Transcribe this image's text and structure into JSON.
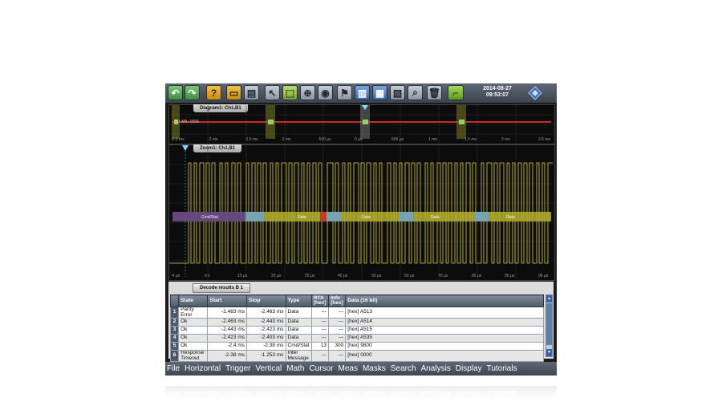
{
  "toolbar": {
    "icons": [
      "undo-icon",
      "redo-icon",
      "help-icon",
      "open-folder-icon",
      "layout-icon",
      "pointer-icon",
      "select-icon",
      "zoom-icon",
      "measure-icon",
      "cursor-icon",
      "mask-icon",
      "histogram-icon",
      "trigger-icon",
      "search-icon",
      "waveform-icon",
      "delete-icon",
      "mini-wave-icon"
    ],
    "date": "2014-08-27",
    "time": "09:53:07"
  },
  "diagram": {
    "tab_label": "Diagram1: Ch1,B1",
    "bus_label": "B1:MIL-1553",
    "x_labels": [
      "-2.5 ms",
      "-2 ms",
      "-1.5 ms",
      "-1 ms",
      "-500 µs",
      "0 µs",
      "500 µs",
      "1 ms",
      "1.5 ms",
      "2 ms",
      "2.5 ms"
    ]
  },
  "zoom": {
    "tab_label": "Zoom1: Ch1,B1",
    "x_labels": [
      "-4 µs",
      "0 s",
      "10 µs",
      "20 µs",
      "30 µs",
      "40 µs",
      "50 µs",
      "60 µs",
      "70 µs",
      "80 µs",
      "90 µs",
      "96 µs"
    ],
    "decode_labels": [
      "Cmd/Stat",
      "Data",
      "Data",
      "Data",
      "Data"
    ]
  },
  "decode": {
    "tab_label": "Decode results B 1",
    "columns": [
      "State",
      "Start",
      "Stop",
      "Type",
      "RTA [hex]",
      "Info [hex]",
      "Data (16 bit)"
    ],
    "rows": [
      {
        "index": "1",
        "state": "Parity Error",
        "start": "-2.483 ms",
        "stop": "-2.463 ms",
        "type": "Data",
        "rta": "---",
        "info": "---",
        "data": "[hex] A513"
      },
      {
        "index": "2",
        "state": "Ok",
        "start": "-2.463 ms",
        "stop": "-2.443 ms",
        "type": "Data",
        "rta": "---",
        "info": "---",
        "data": "[hex] A514"
      },
      {
        "index": "3",
        "state": "Ok",
        "start": "-2.443 ms",
        "stop": "-2.423 ms",
        "type": "Data",
        "rta": "---",
        "info": "---",
        "data": "[hex] A515"
      },
      {
        "index": "4",
        "state": "Ok",
        "start": "-2.423 ms",
        "stop": "-2.403 ms",
        "type": "Data",
        "rta": "---",
        "info": "---",
        "data": "[hex] A535"
      },
      {
        "index": "5",
        "state": "Ok",
        "start": "-2.4 ms",
        "stop": "-2.38 ms",
        "type": "Cmd/Stat",
        "rta": "13",
        "info": "300",
        "data": "[hex] 9800"
      },
      {
        "index": "6",
        "state": "Response Timeout",
        "start": "-2.38 ms",
        "stop": "-1.253 ms",
        "type": "Inter Message",
        "rta": "---",
        "info": "---",
        "data": "[hex] 0000"
      }
    ]
  },
  "menu": [
    "File",
    "Horizontal",
    "Trigger",
    "Vertical",
    "Math",
    "Cursor",
    "Meas",
    "Masks",
    "Search",
    "Analysis",
    "Display",
    "Tutorials"
  ],
  "colors": {
    "signal": "#d8d235",
    "bus_red": "#cc2a2a",
    "decode_green": "#8fd16b",
    "accent_blue": "#2f65b5"
  }
}
